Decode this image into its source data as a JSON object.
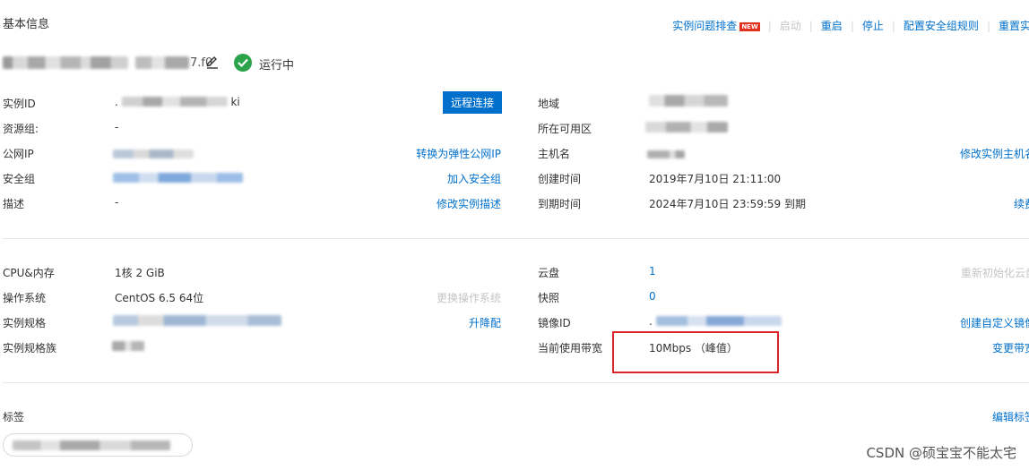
{
  "section": {
    "title": "基本信息"
  },
  "actions": [
    {
      "label": "实例问题排查",
      "enabled": true,
      "badge": "NEW"
    },
    {
      "label": "启动",
      "enabled": false
    },
    {
      "label": "重启",
      "enabled": true
    },
    {
      "label": "停止",
      "enabled": true
    },
    {
      "label": "配置安全组规则",
      "enabled": true
    },
    {
      "label": "重置实例",
      "enabled": true
    }
  ],
  "instance": {
    "name_visible_fragment": "7.f0",
    "status": "运行中",
    "status_color": "#2aa34a"
  },
  "left_basic": [
    {
      "label": "实例ID",
      "value_prefix": ".",
      "value_suffix": "ki"
    },
    {
      "label": "资源组:",
      "value": "-"
    },
    {
      "label": "公网IP",
      "action": "转换为弹性公网IP"
    },
    {
      "label": "安全组",
      "action": "加入安全组"
    },
    {
      "label": "描述",
      "value": "-",
      "action": "修改实例描述"
    }
  ],
  "remote_button": "远程连接",
  "right_basic": [
    {
      "label": "地域"
    },
    {
      "label": "所在可用区"
    },
    {
      "label": "主机名",
      "action": "修改实例主机名"
    },
    {
      "label": "创建时间",
      "value": "2019年7月10日 21:11:00"
    },
    {
      "label": "到期时间",
      "value": "2024年7月10日 23:59:59 到期",
      "action": "续费"
    }
  ],
  "left_config": [
    {
      "label": "CPU&内存",
      "value": "1核 2 GiB"
    },
    {
      "label": "操作系统",
      "value": "CentOS 6.5 64位",
      "action": "更换操作系统",
      "action_enabled": false
    },
    {
      "label": "实例规格",
      "action": "升降配"
    },
    {
      "label": "实例规格族"
    }
  ],
  "right_config": [
    {
      "label": "云盘",
      "value": "1",
      "action": "重新初始化云盘",
      "action_enabled": false
    },
    {
      "label": "快照",
      "value": "0"
    },
    {
      "label": "镜像ID",
      "value_prefix": ".",
      "action": "创建自定义镜像"
    },
    {
      "label": "当前使用带宽",
      "value": "10Mbps （峰值）",
      "action": "变更带宽"
    }
  ],
  "tags": {
    "label": "标签",
    "action": "编辑标签"
  },
  "watermark": "CSDN @硕宝宝不能太宅",
  "colors": {
    "link": "#0070cc",
    "primary": "#0070cc",
    "highlight": "#d9262c",
    "badge": "#e0301e"
  }
}
